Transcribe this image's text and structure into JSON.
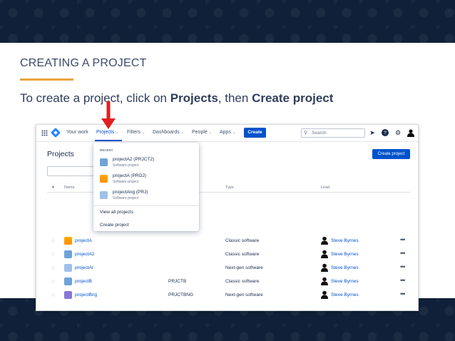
{
  "slide": {
    "title": "CREATING A PROJECT",
    "instruction_pre": "To create a project, click on ",
    "instruction_bold1": "Projects",
    "instruction_mid": ", then ",
    "instruction_bold2": "Create project"
  },
  "topnav": {
    "your_work": "Your work",
    "projects": "Projects",
    "filters": "Filters",
    "dashboards": "Dashboards",
    "people": "People",
    "apps": "Apps",
    "create": "Create",
    "search_placeholder": "Search"
  },
  "page": {
    "title": "Projects",
    "create_project_button": "Create project"
  },
  "table": {
    "headers": {
      "name": "Name",
      "type": "Type",
      "lead": "Lead"
    },
    "rows": [
      {
        "name": "projectA",
        "key": "",
        "type": "Classic software",
        "lead": "Steve Byrnes"
      },
      {
        "name": "projectA2",
        "key": "",
        "type": "Classic software",
        "lead": "Steve Byrnes"
      },
      {
        "name": "projectAr",
        "key": "",
        "type": "Next-gen software",
        "lead": "Steve Byrnes"
      },
      {
        "name": "projectB",
        "key": "PRJCTB",
        "type": "Classic software",
        "lead": "Steve Byrnes"
      },
      {
        "name": "projectBng",
        "key": "PRJCTBNG",
        "type": "Next-gen software",
        "lead": "Steve Byrnes"
      }
    ],
    "more_label": "•••"
  },
  "dropdown": {
    "section_label": "RECENT",
    "items": [
      {
        "name": "projectA2 (PRJCT2)",
        "subtitle": "Software project"
      },
      {
        "name": "projectA (PROJ)",
        "subtitle": "Software project"
      },
      {
        "name": "projectAng (PRJ)",
        "subtitle": "Software project"
      }
    ],
    "view_all": "View all projects",
    "create_project": "Create project"
  },
  "icons": {
    "apps_grid": "grid-icon",
    "logo": "jira-logo-icon",
    "notifications": "rocket-icon",
    "help": "help-icon",
    "settings": "gear-icon",
    "profile": "avatar-icon",
    "arrow": "red-down-arrow"
  },
  "colors": {
    "accent": "#0052cc",
    "underline": "#e8a33c",
    "arrow": "#e02020"
  }
}
